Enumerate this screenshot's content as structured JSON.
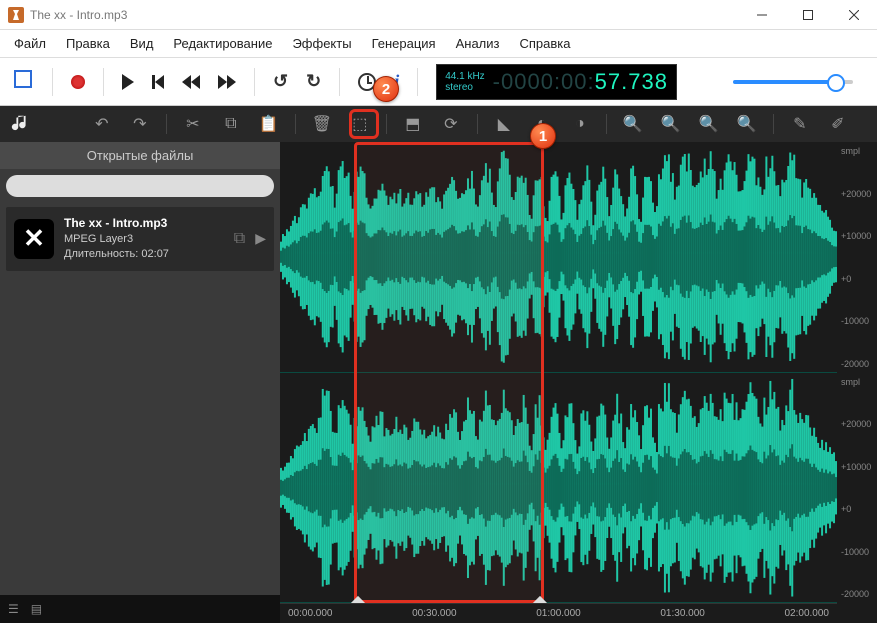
{
  "window": {
    "title": "The xx - Intro.mp3"
  },
  "menu": [
    "Файл",
    "Правка",
    "Вид",
    "Редактирование",
    "Эффекты",
    "Генерация",
    "Анализ",
    "Справка"
  ],
  "lcd": {
    "rate": "44.1 kHz",
    "channels": "stereo",
    "time_dim": "-0000:00:",
    "time_bright": "57.738"
  },
  "sidebar": {
    "heading": "Открытые файлы",
    "search_placeholder": "",
    "file": {
      "name": "The xx - Intro.mp3",
      "codec": "MPEG Layer3",
      "duration_label": "Длительность: 02:07"
    }
  },
  "ruler_v": {
    "unit": "smpl",
    "ticks": [
      "+20000",
      "+10000",
      "+0",
      "-10000",
      "-20000"
    ]
  },
  "ruler_h": [
    "00:00.000",
    "00:30.000",
    "01:00.000",
    "01:30.000",
    "02:00.000"
  ],
  "callouts": {
    "one": "1",
    "two": "2"
  },
  "icons": {
    "undo": "↶",
    "redo": "↷",
    "cut": "✂",
    "copy": "⧉",
    "paste": "📋",
    "delete": "🗑",
    "crop": "⬚",
    "selall": "⬒",
    "refresh": "⟳",
    "ramp": "◣",
    "circ1": "◐",
    "circ2": "◑",
    "zin": "🔍",
    "zout": "🔍",
    "zrst": "🔍",
    "zfit": "🔍",
    "tool1": "✎",
    "tool2": "✐"
  }
}
